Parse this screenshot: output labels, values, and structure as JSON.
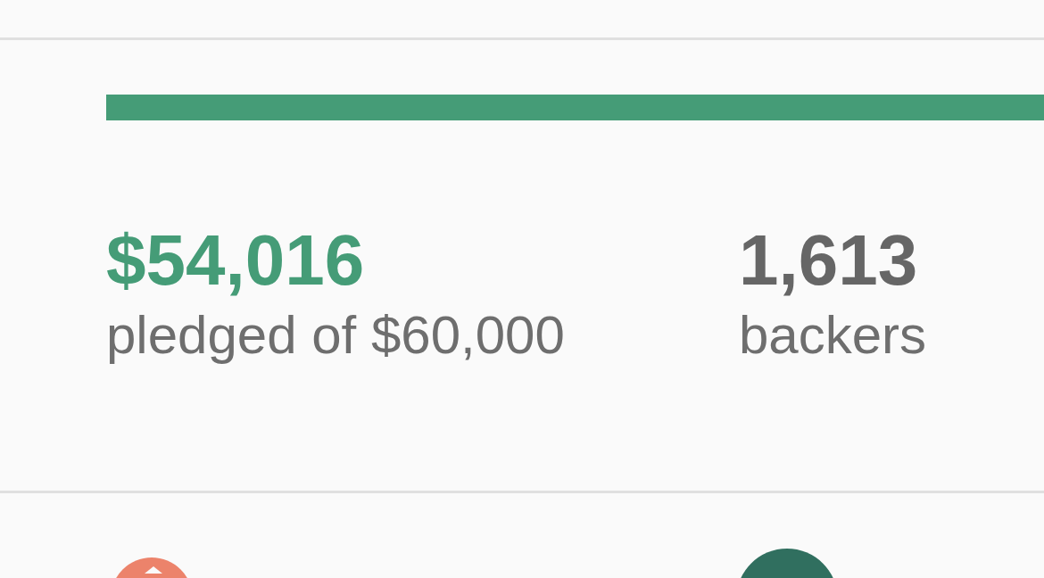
{
  "funding": {
    "level": 0.9
  },
  "stats": [
    {
      "kind": "pledged",
      "value": "$54,016",
      "label": "pledged of $60,000"
    },
    {
      "kind": "backers",
      "value": "1,613",
      "label": "backers"
    }
  ]
}
